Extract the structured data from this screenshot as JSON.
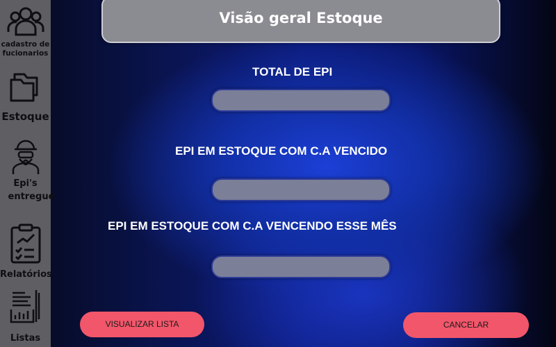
{
  "sidebar": {
    "items": [
      {
        "label": "cadastro de fucionarios",
        "icon": "users-icon"
      },
      {
        "label": "Estoque",
        "icon": "folders-icon"
      },
      {
        "label": "Epi's entregue",
        "icon": "ppe-worker-icon"
      },
      {
        "label": "Relatórios",
        "icon": "clipboard-report-icon"
      },
      {
        "label": "Listas",
        "icon": "list-chart-icon"
      }
    ]
  },
  "header": {
    "title": "Visão geral Estoque"
  },
  "sections": [
    {
      "label": "TOTAL DE EPI",
      "value": ""
    },
    {
      "label": "EPI EM ESTOQUE COM C.A VENCIDO",
      "value": ""
    },
    {
      "label": "EPI EM ESTOQUE COM C.A VENCENDO ESSE MÊS",
      "value": ""
    }
  ],
  "actions": {
    "view_list_label": "VISUALIZAR LISTA",
    "cancel_label": "CANCELAR"
  },
  "colors": {
    "sidebar": "#5e5e63",
    "title_bar": "#8b8b92",
    "field": "#7b7f98",
    "button": "#f2566a"
  }
}
